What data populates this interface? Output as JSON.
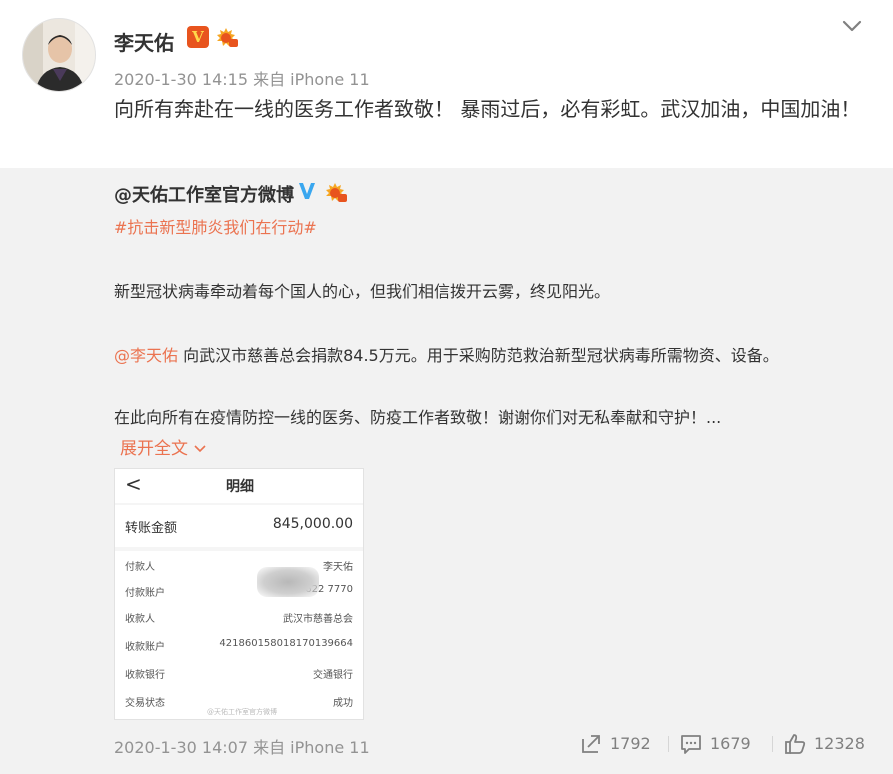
{
  "post": {
    "author": "李天佑",
    "meta": "2020-1-30 14:15 来自 iPhone 11",
    "text": "向所有奔赴在一线的医务工作者致敬！ 暴雨过后，必有彩虹。武汉加油，中国加油！",
    "verified_badge": "V"
  },
  "repost": {
    "author": "@天佑工作室官方微博",
    "hashtag": "#抗击新型肺炎我们在行动#",
    "para1": "新型冠状病毒牵动着每个国人的心，但我们相信拨开云雾，终见阳光。",
    "mention": "@李天佑",
    "para2_rest": " 向武汉市慈善总会捐款84.5万元。用于采购防范救治新型冠状病毒所需物资、设备。",
    "para3": "在此向所有在疫情防控一线的医务、防疫工作者致敬！谢谢你们对无私奉献和守护！...",
    "expand_label": "展开全文",
    "meta": "2020-1-30 14:07 来自 iPhone 11",
    "actions": {
      "repost_count": "1792",
      "comment_count": "1679",
      "like_count": "12328"
    }
  },
  "receipt": {
    "back_glyph": "<",
    "title": "明细",
    "amount_label": "转账金额",
    "amount_value": "845,000.00",
    "rows": [
      {
        "label": "付款人",
        "value": "李天佑"
      },
      {
        "label": "付款账户",
        "value": "622          7770"
      },
      {
        "label": "收款人",
        "value": "武汉市慈善总会"
      },
      {
        "label": "收款账户",
        "value": "421860158018170139664"
      },
      {
        "label": "收款银行",
        "value": "交通银行"
      },
      {
        "label": "交易状态",
        "value": "成功"
      }
    ],
    "watermark": "@天佑工作室官方微博"
  },
  "colors": {
    "link": "#eb7350",
    "muted": "#939393",
    "repost_bg": "#f2f2f2",
    "verified_orange": "#e8541e",
    "verified_blue": "#3aa7ef"
  },
  "icons": [
    "chevron-down-icon",
    "verified-orange-icon",
    "fan-badge-icon",
    "verified-blue-icon",
    "repost-icon",
    "comment-icon",
    "like-icon",
    "back-arrow-icon"
  ]
}
